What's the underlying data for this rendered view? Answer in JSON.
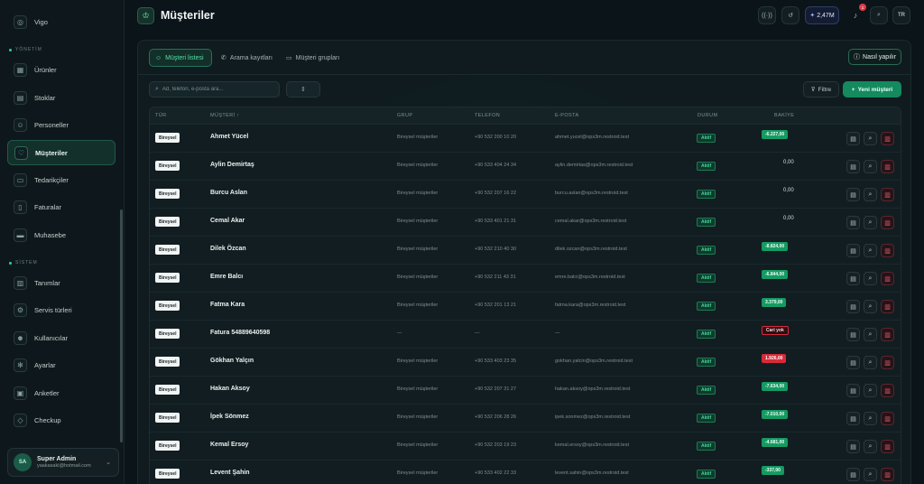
{
  "sidebar": {
    "top_item": {
      "label": "Vigo",
      "icon": "compass-icon"
    },
    "sections": [
      {
        "label": "YÖNETİM"
      },
      {
        "label": "SİSTEM"
      }
    ],
    "items": [
      {
        "label": "Ürünler",
        "icon": "box-icon"
      },
      {
        "label": "Stoklar",
        "icon": "warehouse-icon"
      },
      {
        "label": "Personeller",
        "icon": "users-icon"
      },
      {
        "label": "Müşteriler",
        "icon": "handshake-icon",
        "active": true
      },
      {
        "label": "Tedarikçiler",
        "icon": "truck-icon"
      },
      {
        "label": "Faturalar",
        "icon": "invoice-icon"
      },
      {
        "label": "Muhasebe",
        "icon": "wallet-icon"
      },
      {
        "label": "Tanımlar",
        "icon": "tag-icon"
      },
      {
        "label": "Servis türleri",
        "icon": "wrench-icon"
      },
      {
        "label": "Kullanıcılar",
        "icon": "user-icon"
      },
      {
        "label": "Ayarlar",
        "icon": "gear-icon"
      },
      {
        "label": "Anketler",
        "icon": "clipboard-icon"
      },
      {
        "label": "Checkup",
        "icon": "diamond-icon"
      }
    ],
    "user": {
      "initials": "SA",
      "name": "Super Admin",
      "email": "yaakasaki@hotmail.com"
    }
  },
  "header": {
    "title": "Müşteriler",
    "balance": "2,47M",
    "notifications": "1",
    "lang": "TR"
  },
  "tabs": [
    {
      "label": "Müşteri listesi",
      "icon": "users-icon",
      "active": true
    },
    {
      "label": "Arama kayıtları",
      "icon": "phone-icon"
    },
    {
      "label": "Müşteri grupları",
      "icon": "folder-icon"
    }
  ],
  "help_label": "Nasıl yapılır",
  "toolbar": {
    "search_placeholder": "Ad, telefon, e-posta ara...",
    "select_icon": "⇕",
    "filter_label": "Filtre",
    "new_label": "Yeni müşteri"
  },
  "table": {
    "columns": [
      "TÜR",
      "MÜŞTERİ ↑",
      "GRUP",
      "TELEFON",
      "E-POSTA",
      "DURUM",
      "BAKİYE"
    ],
    "rows": [
      {
        "type": "Bireysel",
        "name": "Ahmet Yücel",
        "group": "Bireysel müşteriler",
        "phone": "+90 532 200 10 20",
        "email": "ahmet.yucel@ops3m.restroid.test",
        "status": "Aktif",
        "balance": "-6.227,00",
        "balance_style": "green"
      },
      {
        "type": "Bireysel",
        "name": "Aylin Demirtaş",
        "group": "Bireysel müşteriler",
        "phone": "+90 533 404 24 34",
        "email": "aylin.demirtas@ops3m.restroid.test",
        "status": "Aktif",
        "balance": "0,00",
        "balance_style": "plain"
      },
      {
        "type": "Bireysel",
        "name": "Burcu Aslan",
        "group": "Bireysel müşteriler",
        "phone": "+90 532 207 16 22",
        "email": "burcu.aslan@ops3m.restroid.test",
        "status": "Aktif",
        "balance": "0,00",
        "balance_style": "plain"
      },
      {
        "type": "Bireysel",
        "name": "Cemal Akar",
        "group": "Bireysel müşteriler",
        "phone": "+90 533 401 21 31",
        "email": "cemal.akar@ops3m.restroid.test",
        "status": "Aktif",
        "balance": "0,00",
        "balance_style": "plain"
      },
      {
        "type": "Bireysel",
        "name": "Dilek Özcan",
        "group": "Bireysel müşteriler",
        "phone": "+90 532 210 40 30",
        "email": "dilek.ozcan@ops3m.restroid.test",
        "status": "Aktif",
        "balance": "-8.824,00",
        "balance_style": "green"
      },
      {
        "type": "Bireysel",
        "name": "Emre Balcı",
        "group": "Bireysel müşteriler",
        "phone": "+90 532 211 43 31",
        "email": "emre.balci@ops3m.restroid.test",
        "status": "Aktif",
        "balance": "-6.844,00",
        "balance_style": "green"
      },
      {
        "type": "Bireysel",
        "name": "Fatma Kara",
        "group": "Bireysel müşteriler",
        "phone": "+90 532 201 13 21",
        "email": "fatma.kara@ops3m.restroid.test",
        "status": "Aktif",
        "balance": "3.379,00",
        "balance_style": "green"
      },
      {
        "type": "Bireysel",
        "name": "Fatura 54889640598",
        "group": "—",
        "phone": "—",
        "email": "—",
        "status": "Aktif",
        "balance": "Cari yok",
        "balance_style": "outline"
      },
      {
        "type": "Bireysel",
        "name": "Gökhan Yalçın",
        "group": "Bireysel müşteriler",
        "phone": "+90 533 403 23 35",
        "email": "gokhan.yalcin@ops3m.restroid.test",
        "status": "Aktif",
        "balance": "1.926,00",
        "balance_style": "red"
      },
      {
        "type": "Bireysel",
        "name": "Hakan Aksoy",
        "group": "Bireysel müşteriler",
        "phone": "+90 532 207 31 27",
        "email": "hakan.aksoy@ops3m.restroid.test",
        "status": "Aktif",
        "balance": "-7.634,00",
        "balance_style": "green"
      },
      {
        "type": "Bireysel",
        "name": "İpek Sönmez",
        "group": "Bireysel müşteriler",
        "phone": "+90 532 206 28 26",
        "email": "ipek.sonmez@ops3m.restroid.test",
        "status": "Aktif",
        "balance": "-7.010,00",
        "balance_style": "green"
      },
      {
        "type": "Bireysel",
        "name": "Kemal Ersoy",
        "group": "Bireysel müşteriler",
        "phone": "+90 532 203 19 23",
        "email": "kemal.ersoy@ops3m.restroid.test",
        "status": "Aktif",
        "balance": "-4.681,00",
        "balance_style": "green"
      },
      {
        "type": "Bireysel",
        "name": "Levent Şahin",
        "group": "Bireysel müşteriler",
        "phone": "+90 533 402 22 33",
        "email": "levent.sahin@ops3m.restroid.test",
        "status": "Aktif",
        "balance": "-337,00",
        "balance_style": "green"
      }
    ]
  }
}
